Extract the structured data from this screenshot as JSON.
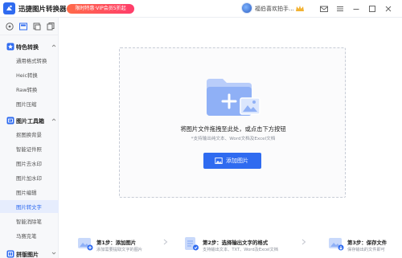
{
  "app": {
    "title": "迅捷图片转换器",
    "promo_text": "限时特惠·VIP会员5折起",
    "username": "福伯喜欢拍手..."
  },
  "sidebar": {
    "sections": [
      {
        "label": "特色转换",
        "icon": "star-icon",
        "items": [
          {
            "label": "通用格式转换"
          },
          {
            "label": "Heic转换"
          },
          {
            "label": "Raw转换"
          },
          {
            "label": "图片压缩"
          }
        ]
      },
      {
        "label": "图片工具箱",
        "icon": "toolbox-icon",
        "items": [
          {
            "label": "抠图换背景"
          },
          {
            "label": "智能证件照"
          },
          {
            "label": "图片去水印"
          },
          {
            "label": "图片加水印"
          },
          {
            "label": "图片编辑"
          },
          {
            "label": "图片转文字",
            "active": true
          },
          {
            "label": "智能消除笔"
          },
          {
            "label": "马赛克笔"
          }
        ]
      },
      {
        "label": "拼版图片",
        "icon": "layout-icon"
      }
    ]
  },
  "dropzone": {
    "title": "将图片文件拖拽至此处，或点击下方按钮",
    "subtitle": "*支持输出纯文本、Word文档及Excel文档",
    "button_label": "添加图片"
  },
  "steps": [
    {
      "title": "第1步：添加图片",
      "desc": "添加需要提取文字的图片"
    },
    {
      "title": "第2步：选择输出文字的格式",
      "desc": "支持输出文本、TXT、Word及Excel文档"
    },
    {
      "title": "第3步：保存文件",
      "desc": "保存输出的文件即可"
    }
  ],
  "colors": {
    "accent": "#2f6bf0",
    "active_bg": "#e6edfd",
    "promo_start": "#ff6b4a",
    "promo_end": "#ff3d6b"
  }
}
